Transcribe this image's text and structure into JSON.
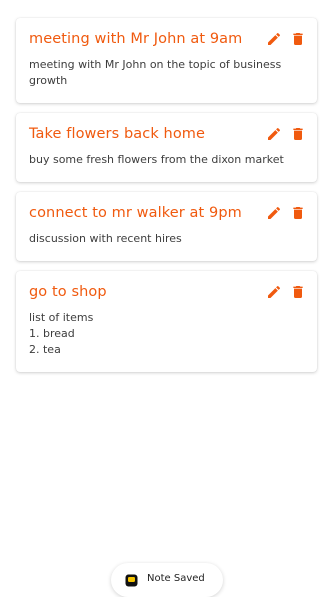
{
  "notes": [
    {
      "title": "meeting with Mr John at 9am",
      "body": "meeting with Mr John on the topic of business growth"
    },
    {
      "title": "Take flowers back home",
      "body": "buy some fresh flowers from the dixon market"
    },
    {
      "title": "connect to mr walker at 9pm",
      "body": "discussion with recent hires"
    },
    {
      "title": "go to shop",
      "body": "list of items\n1. bread\n2. tea"
    }
  ],
  "icons": {
    "edit": "pencil-icon",
    "delete": "trash-icon",
    "toast": "app-logo-icon"
  },
  "colors": {
    "accent": "#f05a0f",
    "text": "#3d3d3d"
  },
  "toast": {
    "message": "Note Saved"
  }
}
